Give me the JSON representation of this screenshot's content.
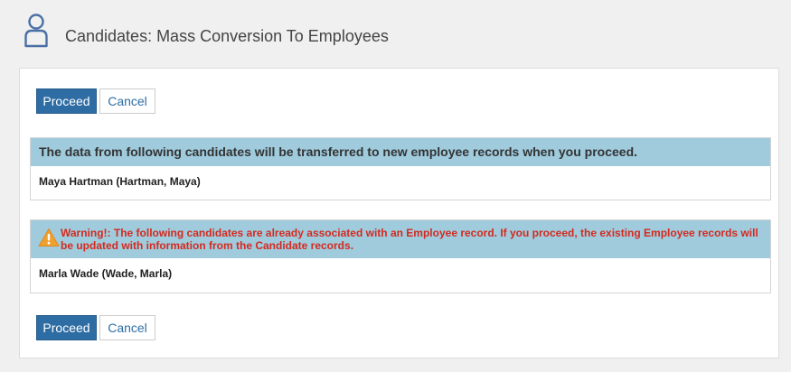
{
  "header": {
    "title": "Candidates: Mass Conversion To Employees",
    "icon": "user-icon"
  },
  "actions_top": {
    "proceed_label": "Proceed",
    "cancel_label": "Cancel"
  },
  "transfer_section": {
    "message": "The data from following candidates will be transferred to new employee records when you proceed.",
    "candidates": [
      "Maya Hartman (Hartman, Maya)"
    ]
  },
  "warning_section": {
    "icon": "warning-icon",
    "message": "Warning!: The following candidates are already associated with an Employee record. If you proceed, the existing Employee records will be updated with information from the Candidate records.",
    "candidates": [
      "Marla Wade (Wade, Marla)"
    ]
  },
  "actions_bottom": {
    "proceed_label": "Proceed",
    "cancel_label": "Cancel"
  },
  "colors": {
    "primary": "#2e6da4",
    "section_header": "#9fcbdd",
    "warning_text": "#d42a1e",
    "warning_icon": "#f0a030"
  }
}
